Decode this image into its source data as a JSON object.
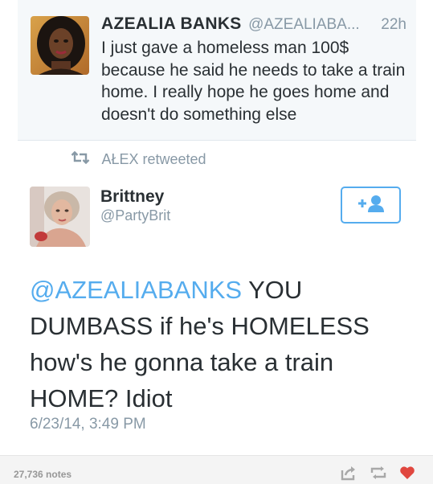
{
  "quoted_tweet": {
    "name": "AZEALIA BANKS",
    "handle": "@AZEALIABA...",
    "time": "22h",
    "text": "I just gave a homeless man 100$ because he said he needs to take a train home. I really hope he goes home and doesn't do something else"
  },
  "retweet_context": {
    "label": "AŁEX retweeted",
    "icon": "retweet-icon"
  },
  "main_tweet": {
    "name": "Brittney",
    "handle": "@PartyBrit",
    "follow_icon": "follow-user-icon",
    "mention": "@AZEALIABANKS",
    "text_rest": " YOU DUMBASS if he's HOMELESS how's he gonna take a train HOME? Idiot",
    "date": "6/23/14, 3:49 PM"
  },
  "footer": {
    "notes": "27,736 notes",
    "icons": [
      "share-icon",
      "reblog-icon",
      "like-heart-icon"
    ],
    "accent_like": "#e0473f",
    "accent_twitter": "#55acee"
  }
}
